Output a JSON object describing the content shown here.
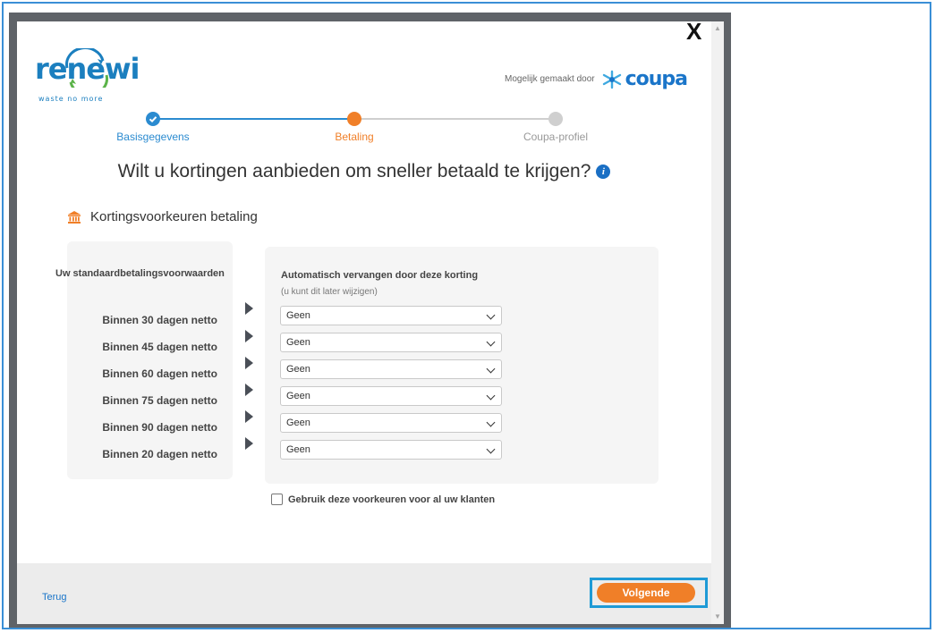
{
  "logo": {
    "brand": "renewi",
    "tagline": "waste no more"
  },
  "powered_by": {
    "text": "Mogelijk gemaakt door",
    "brand": "coupa"
  },
  "close_label": "X",
  "steps": [
    {
      "label": "Basisgegevens",
      "state": "done",
      "color": "#2b8bd0"
    },
    {
      "label": "Betaling",
      "state": "active",
      "color": "#f07f28"
    },
    {
      "label": "Coupa-profiel",
      "state": "pending",
      "color": "#999999"
    }
  ],
  "title": "Wilt u kortingen aanbieden om sneller betaald te krijgen?",
  "section": {
    "title": "Kortingsvoorkeuren betaling",
    "icon": "bank-icon"
  },
  "left_header": "Uw standaardbetalingsvoorwaarden",
  "right_header": "Automatisch vervangen door deze korting",
  "right_subheader": "(u kunt dit later wijzigen)",
  "terms": [
    {
      "label": "Binnen 30 dagen netto",
      "selected": "Geen"
    },
    {
      "label": "Binnen 45 dagen netto",
      "selected": "Geen"
    },
    {
      "label": "Binnen 60 dagen netto",
      "selected": "Geen"
    },
    {
      "label": "Binnen 75 dagen netto",
      "selected": "Geen"
    },
    {
      "label": "Binnen 90 dagen netto",
      "selected": "Geen"
    },
    {
      "label": "Binnen 20 dagen netto",
      "selected": "Geen"
    }
  ],
  "checkbox": {
    "label": "Gebruik deze voorkeuren voor al uw klanten",
    "checked": false
  },
  "footer": {
    "back_label": "Terug",
    "next_label": "Volgende"
  },
  "colors": {
    "accent": "#f07f28",
    "link": "#1a75c9",
    "highlight": "#1e9ad6"
  }
}
